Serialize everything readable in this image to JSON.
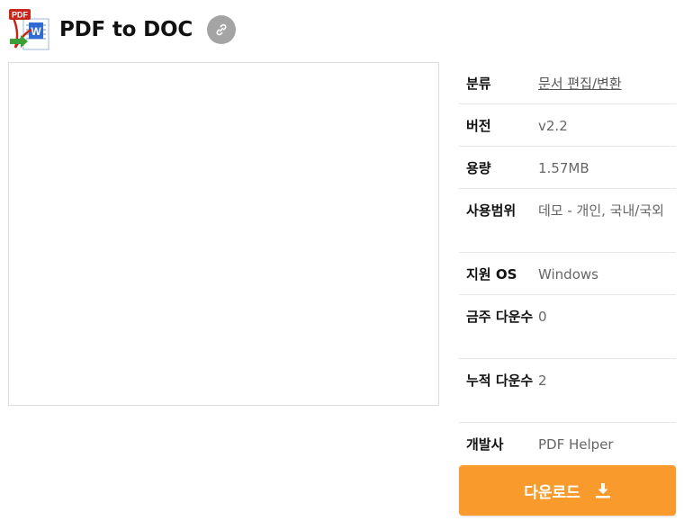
{
  "app": {
    "title": "PDF to DOC",
    "icon_badge": "PDF",
    "icon_letter": "W",
    "link_icon": "link-icon"
  },
  "info": {
    "rows": [
      {
        "label": "분류",
        "value": "문서 편집/변환"
      },
      {
        "label": "버전",
        "value": "v2.2"
      },
      {
        "label": "용량",
        "value": "1.57MB"
      },
      {
        "label": "사용범위",
        "value": "데모 - 개인, 국내/국외"
      },
      {
        "label": "지원 OS",
        "value": "Windows"
      },
      {
        "label": "금주 다운수",
        "value": "0"
      },
      {
        "label": "누적 다운수",
        "value": "2"
      },
      {
        "label": "개발사",
        "value": "PDF Helper"
      }
    ]
  },
  "download": {
    "label": "다운로드",
    "icon": "download-icon"
  },
  "colors": {
    "accent": "#f89b2c",
    "link_button": "#a4a4a4"
  }
}
